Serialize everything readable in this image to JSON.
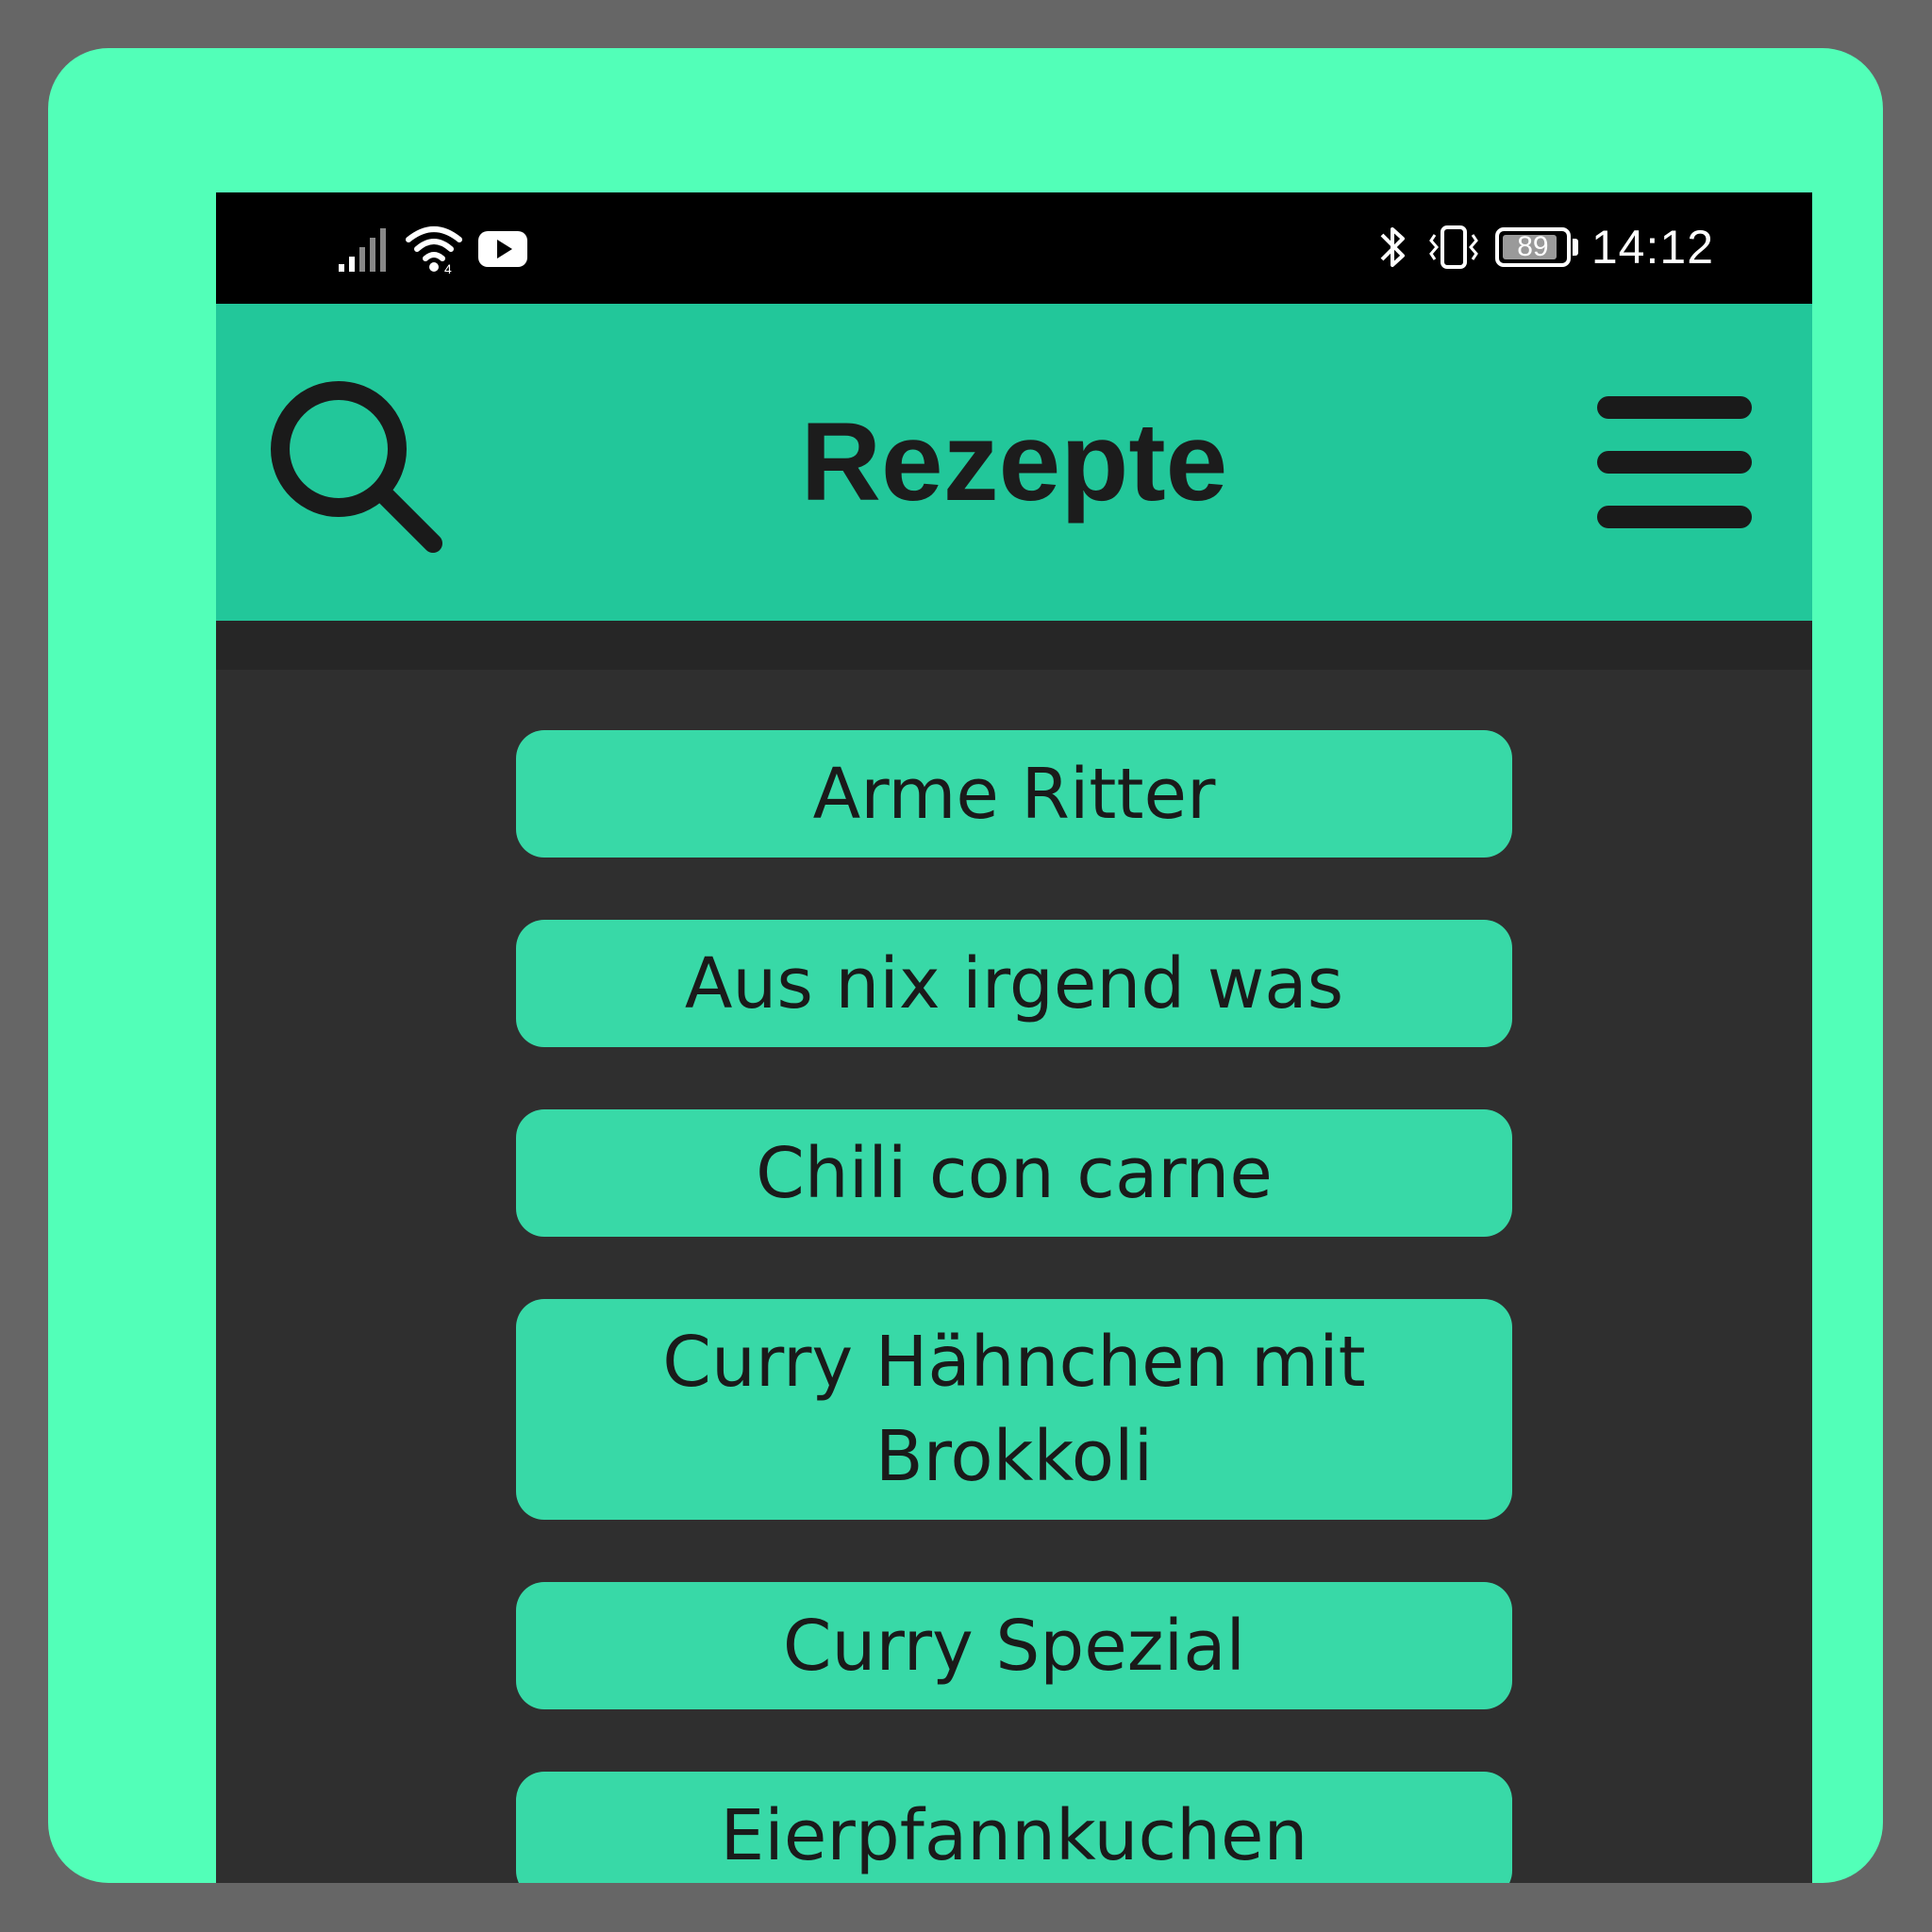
{
  "status_bar": {
    "time": "14:12",
    "battery_level": "89",
    "battery_fraction": 0.89,
    "left_icons": [
      "signal-icon",
      "wifi-icon",
      "youtube-icon"
    ],
    "right_icons": [
      "bluetooth-icon",
      "vibrate-icon",
      "battery-icon"
    ]
  },
  "header": {
    "title": "Rezepte",
    "search_icon": "search-icon",
    "menu_icon": "hamburger-menu-icon"
  },
  "recipes": [
    "Arme Ritter",
    "Aus nix irgend was",
    "Chili con carne",
    "Curry Hähnchen mit Brokkoli",
    "Curry Spezial",
    "Eierpfannkuchen"
  ],
  "colors": {
    "outer_background": "#666666",
    "frame": "#52ffb8",
    "app_bar": "#22c79a",
    "button": "#38d9a7",
    "content_background": "#2f2f2f",
    "text": "#1a1a1a"
  }
}
